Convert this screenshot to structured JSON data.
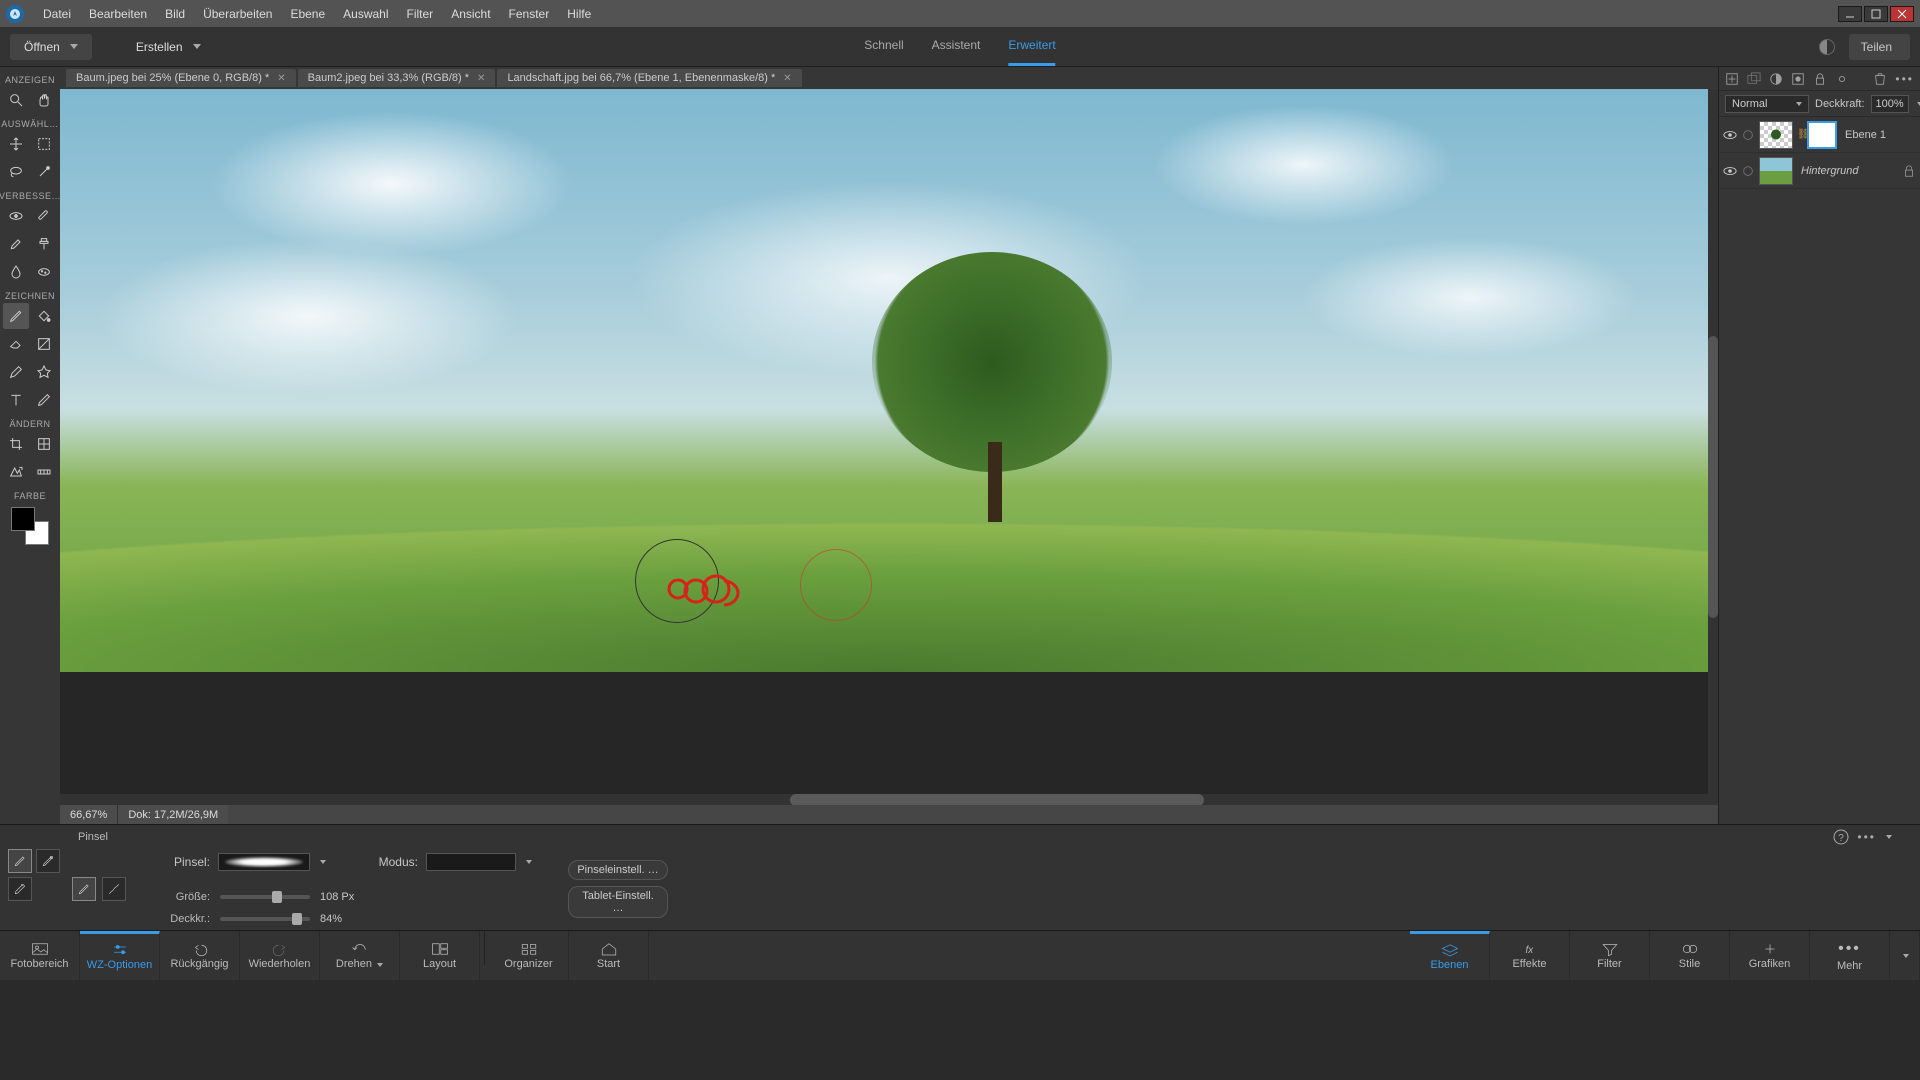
{
  "menubar": [
    "Datei",
    "Bearbeiten",
    "Bild",
    "Überarbeiten",
    "Ebene",
    "Auswahl",
    "Filter",
    "Ansicht",
    "Fenster",
    "Hilfe"
  ],
  "actionbar": {
    "open": "Öffnen",
    "create": "Erstellen",
    "modes": {
      "quick": "Schnell",
      "guided": "Assistent",
      "expert": "Erweitert"
    },
    "share": "Teilen"
  },
  "doc_tabs": [
    {
      "label": "Baum.jpeg bei 25% (Ebene 0, RGB/8) *"
    },
    {
      "label": "Baum2.jpeg bei 33,3% (RGB/8) *"
    },
    {
      "label": "Landschaft.jpg bei 66,7% (Ebene 1, Ebenenmaske/8) *"
    }
  ],
  "tool_sections": {
    "view": "ANZEIGEN",
    "select": "AUSWÄHL…",
    "enhance": "VERBESSE…",
    "draw": "ZEICHNEN",
    "modify": "ÄNDERN",
    "color": "FARBE"
  },
  "status": {
    "zoom": "66,67%",
    "doc": "Dok: 17,2M/26,9M"
  },
  "layers": {
    "blend_label": "Normal",
    "opacity_label": "Deckkraft:",
    "opacity_value": "100%",
    "rows": [
      {
        "name": "Ebene 1"
      },
      {
        "name": "Hintergrund"
      }
    ]
  },
  "options": {
    "title": "Pinsel",
    "brush_label": "Pinsel:",
    "mode_label": "Modus:",
    "size_label": "Größe:",
    "size_value": "108 Px",
    "opacity_label": "Deckkr.:",
    "opacity_value": "84%",
    "brush_settings": "Pinseleinstell. …",
    "tablet_settings": "Tablet-Einstell. …"
  },
  "taskbar": {
    "left": [
      "Fotobereich",
      "WZ-Optionen",
      "Rückgängig",
      "Wiederholen",
      "Drehen",
      "Layout"
    ],
    "mid": [
      "Organizer",
      "Start"
    ],
    "right": [
      "Ebenen",
      "Effekte",
      "Filter",
      "Stile",
      "Grafiken",
      "Mehr"
    ]
  }
}
